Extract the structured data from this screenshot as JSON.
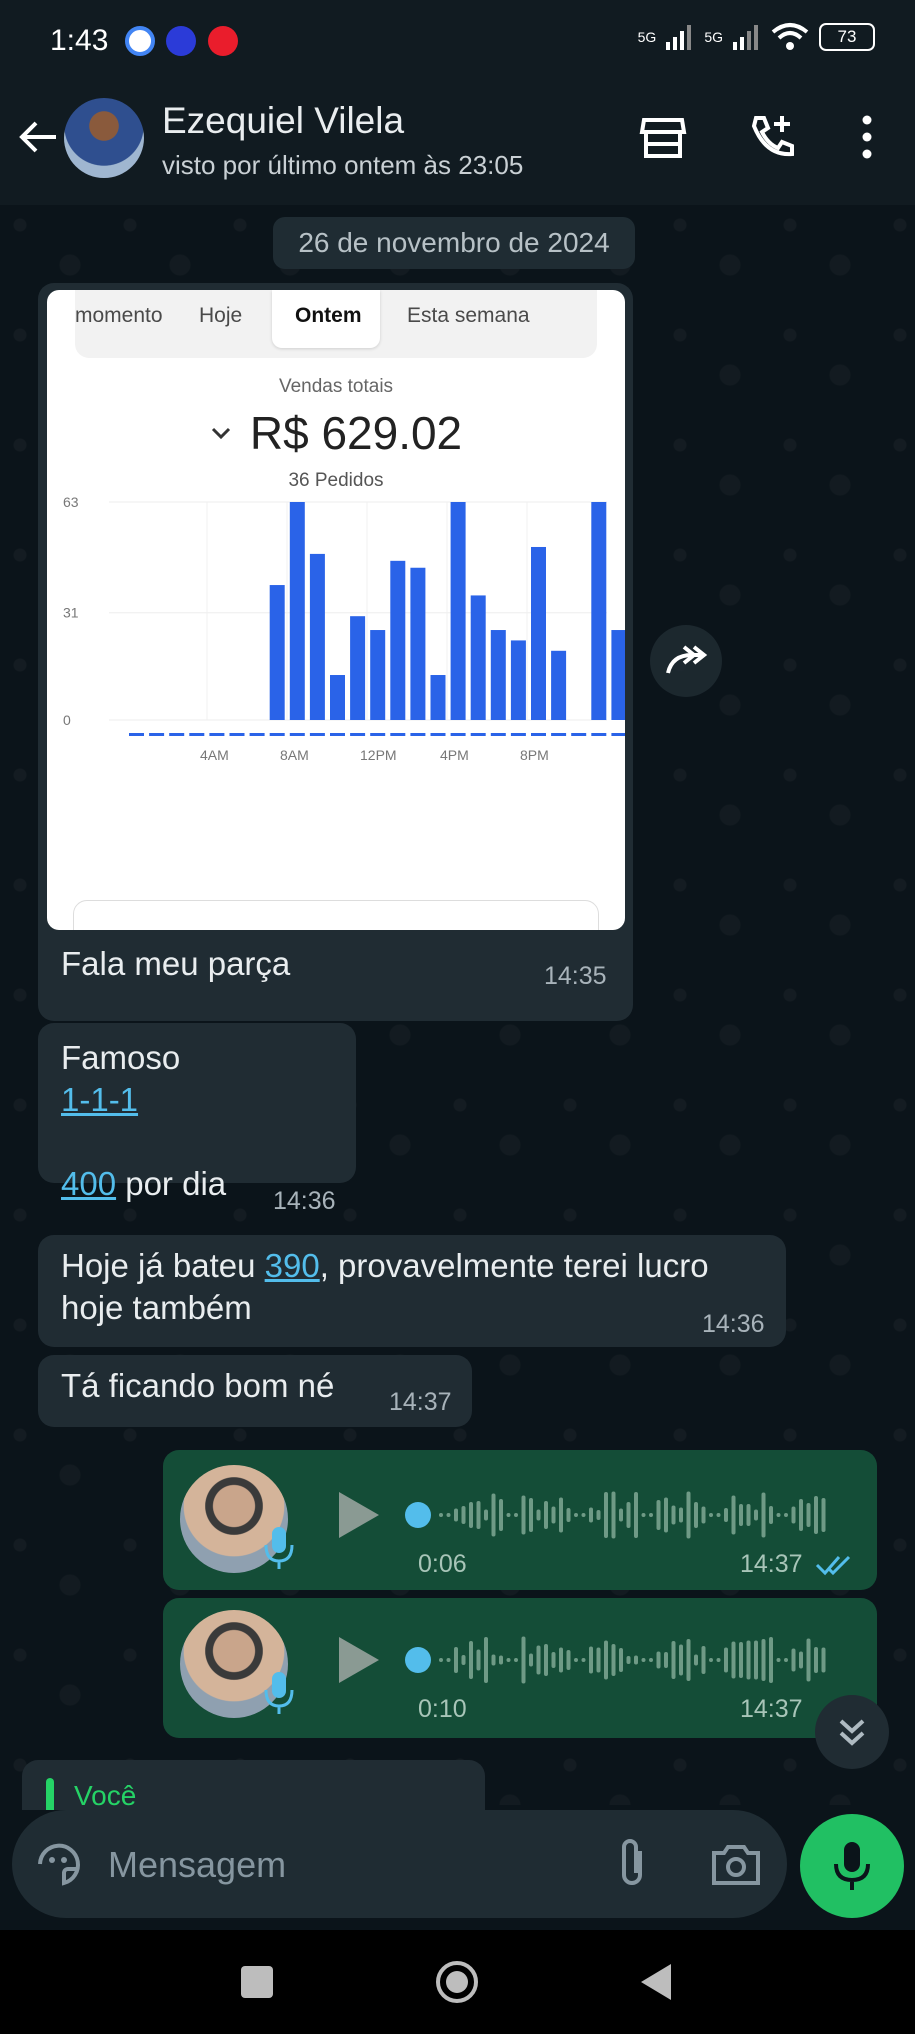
{
  "status_bar": {
    "time": "1:43",
    "signal1": "5G",
    "signal2": "5G",
    "battery": "73"
  },
  "header": {
    "name": "Ezequiel Vilela",
    "status": "visto por último ontem às 23:05"
  },
  "date_separator": "26 de novembro de 2024",
  "image_message": {
    "tabs": [
      "momento",
      "Hoje",
      "Ontem",
      "Esta semana"
    ],
    "active_tab": "Ontem",
    "total_label": "Vendas totais",
    "total_value": "R$ 629.02",
    "orders": "36 Pedidos",
    "caption": "Fala meu parça",
    "time": "14:35"
  },
  "chart_data": {
    "type": "bar",
    "y_ticks": [
      "0",
      "31",
      "63"
    ],
    "x_tick_labels": [
      "4AM",
      "8AM",
      "12PM",
      "4PM",
      "8PM"
    ],
    "ylim": [
      0,
      63
    ],
    "hours": [
      0,
      1,
      2,
      3,
      4,
      5,
      6,
      7,
      8,
      9,
      10,
      11,
      12,
      13,
      14,
      15,
      16,
      17,
      18,
      19,
      20,
      21,
      22,
      23
    ],
    "values": [
      0,
      0,
      0,
      0,
      0,
      0,
      0,
      39,
      63,
      48,
      13,
      30,
      26,
      46,
      44,
      13,
      63,
      36,
      26,
      23,
      50,
      20,
      0,
      63,
      26
    ],
    "color": "#2a63e8"
  },
  "messages": [
    {
      "line1": "Famoso",
      "link1": "1-1-1",
      "link2": "400",
      "line3_rest": " por dia",
      "time": "14:36"
    },
    {
      "pre": "Hoje já bateu ",
      "link": "390",
      "post": ", provavelmente terei lucro",
      "line2": "hoje também",
      "time": "14:36"
    },
    {
      "text": "Tá ficando bom né",
      "time": "14:37"
    }
  ],
  "voice_messages": [
    {
      "duration": "0:06",
      "time": "14:37",
      "read": true
    },
    {
      "duration": "0:10",
      "time": "14:37",
      "read": false
    }
  ],
  "quote": {
    "name": "Você"
  },
  "composer": {
    "placeholder": "Mensagem"
  },
  "colors": {
    "bg": "#0b141a",
    "incoming": "#202c33",
    "outgoing": "#144d37",
    "accent": "#25d366",
    "link": "#53bdeb"
  }
}
